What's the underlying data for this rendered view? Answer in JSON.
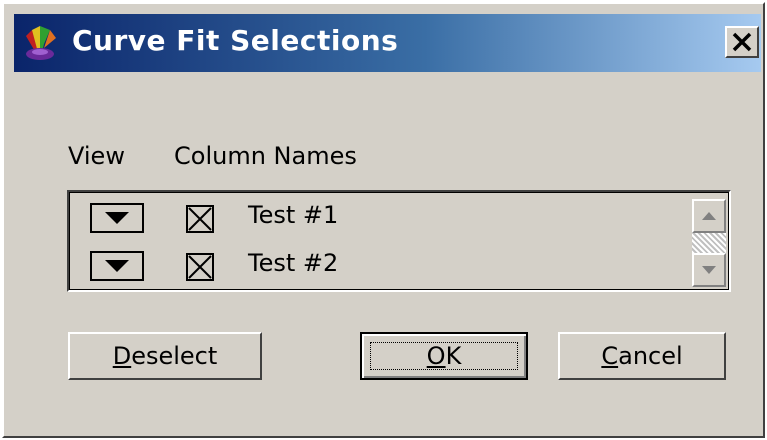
{
  "dialog": {
    "title": "Curve Fit Selections",
    "icon": "palette-app-icon",
    "close_label": "X"
  },
  "headers": {
    "view": "View",
    "column_names": "Column Names"
  },
  "rows": [
    {
      "view_icon": "dropdown-arrow-icon",
      "checked": true,
      "name": "Test #1"
    },
    {
      "view_icon": "dropdown-arrow-icon",
      "checked": true,
      "name": "Test #2"
    }
  ],
  "buttons": {
    "deselect": {
      "first": "D",
      "rest": "eselect"
    },
    "ok": {
      "first": "O",
      "rest": "K"
    },
    "cancel": {
      "first": "C",
      "rest": "ancel"
    }
  },
  "colors": {
    "title_start": "#0a246a",
    "title_end": "#a6caf0",
    "face": "#d4d0c8"
  }
}
